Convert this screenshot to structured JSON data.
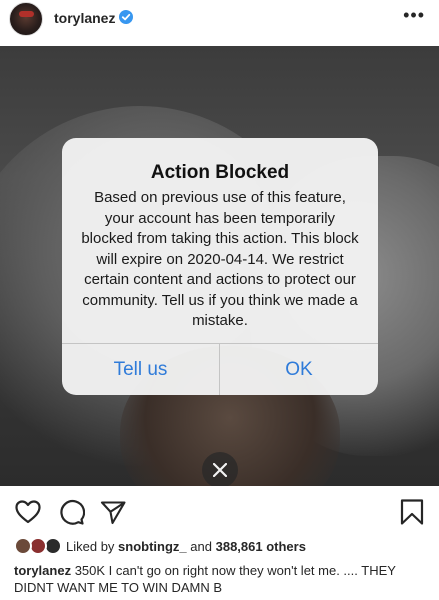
{
  "post": {
    "username": "torylanez",
    "more_label": "•••"
  },
  "dialog": {
    "title": "Action Blocked",
    "message": "Based on previous use of this feature, your account has been temporarily blocked from taking this action. This block will expire on 2020-04-14. We restrict certain content and actions to protect our community. Tell us if you think we made a mistake.",
    "left_button": "Tell us",
    "right_button": "OK"
  },
  "icons": {
    "like": "heart-icon",
    "comment": "comment-icon",
    "share": "send-icon",
    "save": "bookmark-icon",
    "close": "close-icon",
    "verified": "verified-badge-icon"
  },
  "likes": {
    "prefix": "Liked by",
    "user": "snobtingz_",
    "middle": "and",
    "count": "388,861 others"
  },
  "caption": {
    "user": "torylanez",
    "text": "350K I can't go on right now they won't let me. .... THEY DIDNT WANT ME TO WIN DAMN B"
  },
  "colors": {
    "accent_blue": "#2f7bd9",
    "verified_blue": "#3897f0",
    "text": "#262626"
  }
}
